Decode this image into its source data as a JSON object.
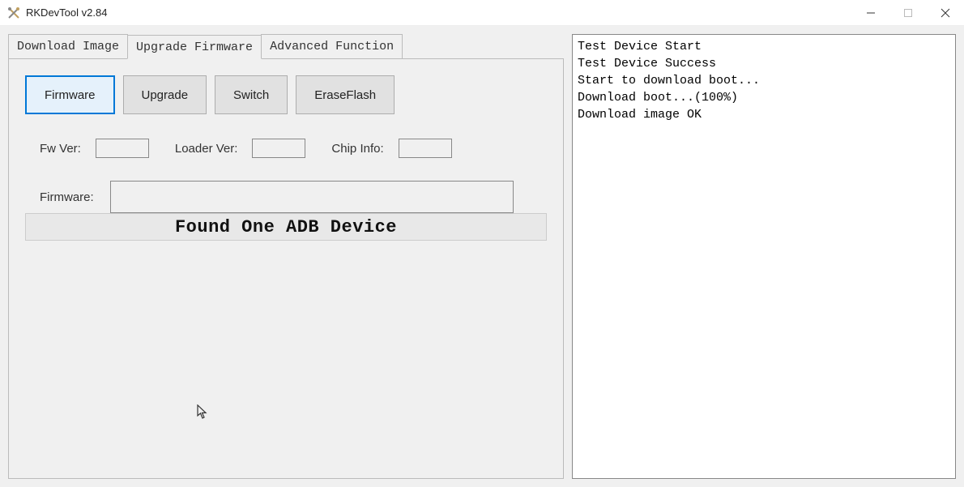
{
  "window": {
    "title": "RKDevTool v2.84"
  },
  "tabs": {
    "downloadImage": "Download Image",
    "upgradeFirmware": "Upgrade Firmware",
    "advancedFunction": "Advanced Function"
  },
  "buttons": {
    "firmware": "Firmware",
    "upgrade": "Upgrade",
    "switch": "Switch",
    "eraseFlash": "EraseFlash"
  },
  "labels": {
    "fwVer": "Fw Ver:",
    "loaderVer": "Loader Ver:",
    "chipInfo": "Chip Info:",
    "firmware": "Firmware:"
  },
  "values": {
    "fwVer": "",
    "loaderVer": "",
    "chipInfo": "",
    "firmware": ""
  },
  "status": "Found One ADB Device",
  "log": [
    "Test Device Start",
    "Test Device Success",
    "Start to download boot...",
    "Download boot...(100%)",
    "Download image OK"
  ]
}
